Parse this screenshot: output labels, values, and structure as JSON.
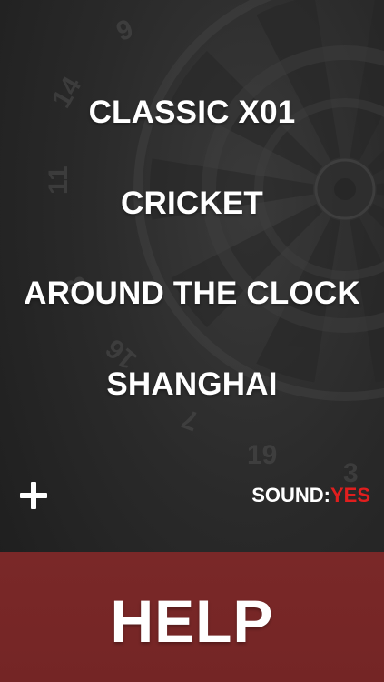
{
  "menu": {
    "items": [
      {
        "label": "CLASSIC X01"
      },
      {
        "label": "CRICKET"
      },
      {
        "label": "AROUND THE CLOCK"
      },
      {
        "label": "SHANGHAI"
      }
    ]
  },
  "controls": {
    "add_icon": "plus-icon",
    "sound_label": "SOUND:",
    "sound_value": "YES"
  },
  "help": {
    "label": "HELP"
  },
  "background": {
    "board_numbers": [
      "9",
      "14",
      "11",
      "8",
      "16",
      "7",
      "19",
      "3"
    ]
  },
  "colors": {
    "accent_red": "#e01e1e",
    "help_bar": "#7a2828",
    "text": "#ffffff"
  }
}
